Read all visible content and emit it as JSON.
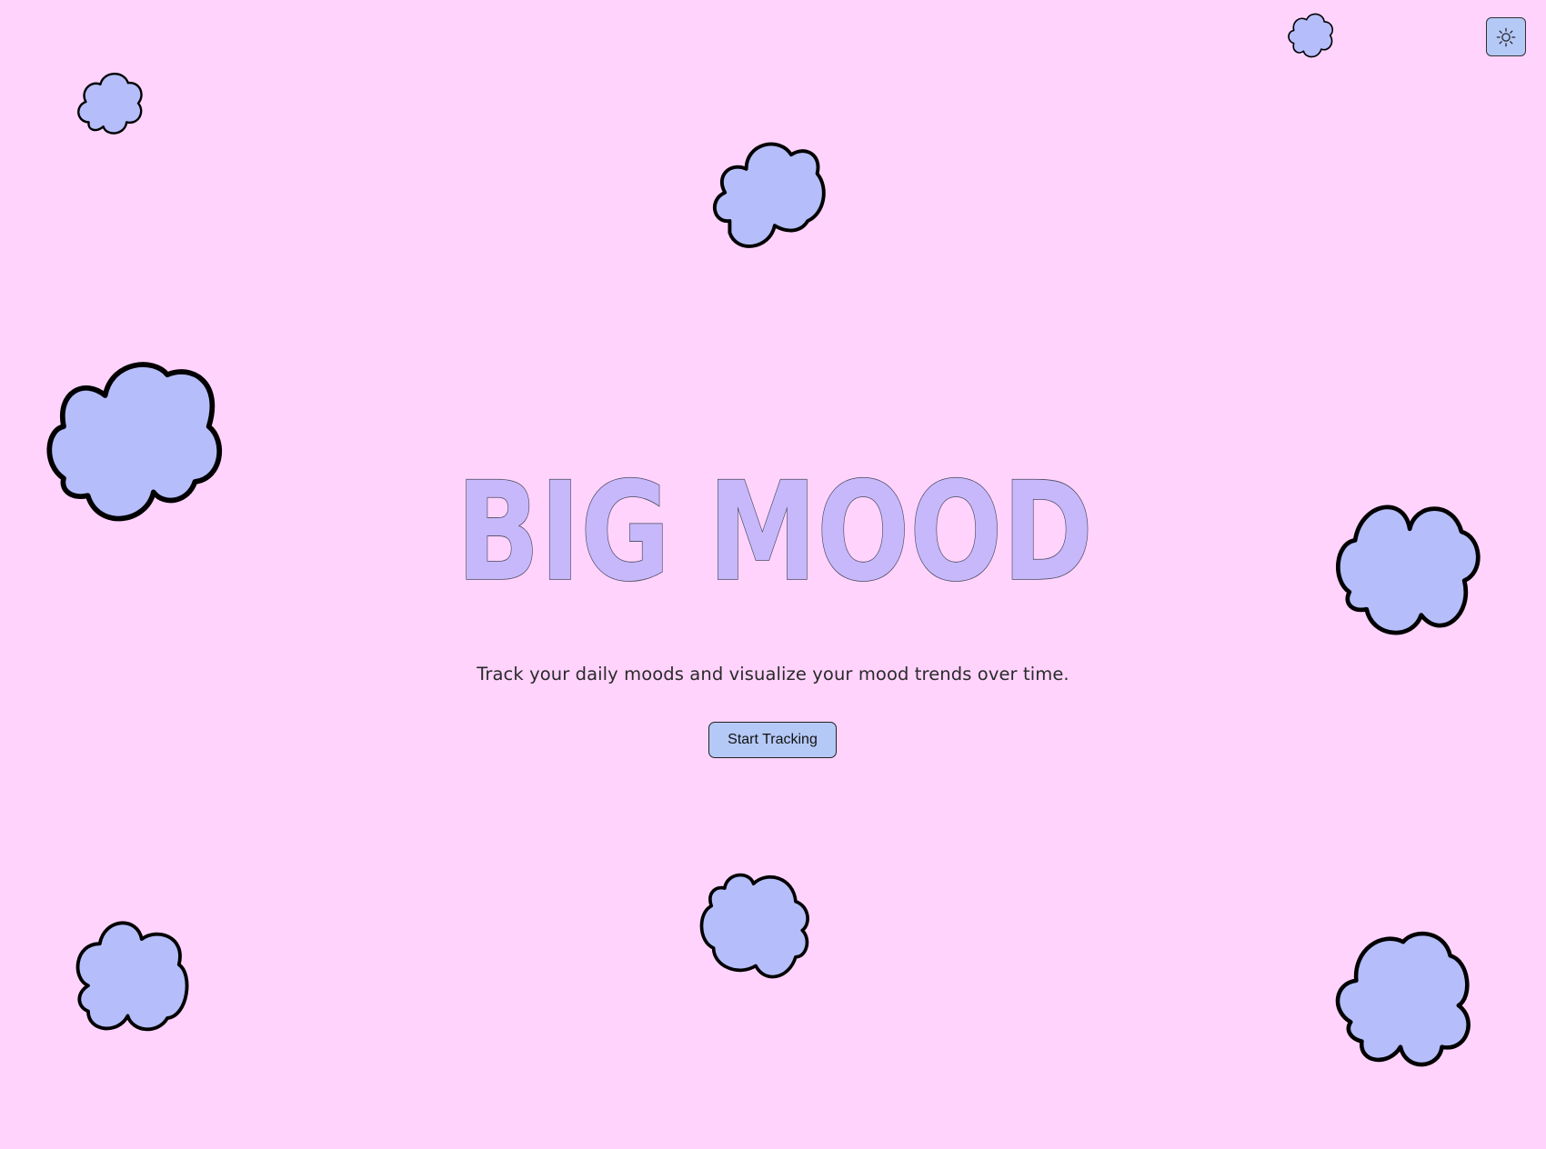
{
  "app": {
    "title": "BIG MOOD",
    "subtitle": "Track your daily moods and visualize your mood trends over time.",
    "cta_label": "Start Tracking"
  },
  "header": {
    "theme_toggle_icon": "sun-icon"
  },
  "colors": {
    "background": "#ffd3fc",
    "cloud_fill": "#b5bdfb",
    "title_fill": "#c7b8fb",
    "button_fill": "#b5c9f7"
  }
}
